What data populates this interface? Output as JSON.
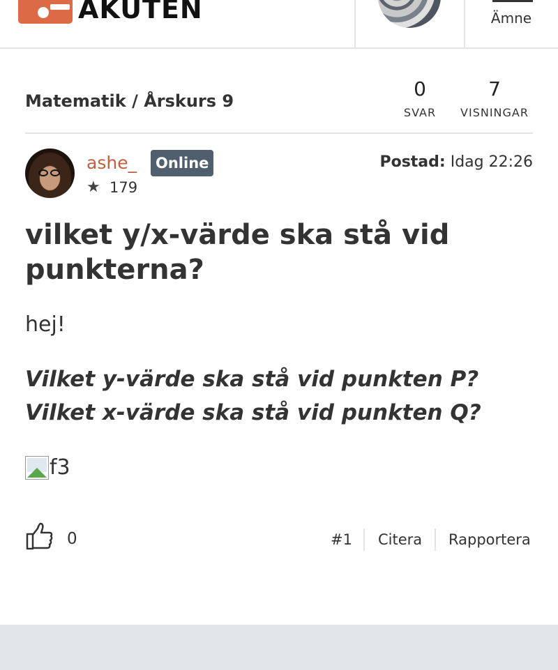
{
  "header": {
    "logo_text": "AKUTEN",
    "menu_label": "Ämne"
  },
  "breadcrumb": {
    "subject": "Matematik",
    "separator": "/",
    "grade": "Årskurs 9"
  },
  "stats": {
    "answers_count": "0",
    "answers_label": "SVAR",
    "views_count": "7",
    "views_label": "VISNINGAR"
  },
  "author": {
    "username": "ashe_",
    "status_badge": "Online",
    "points": "179"
  },
  "posted": {
    "label": "Postad:",
    "time": "Idag 22:26"
  },
  "post": {
    "title": "vilket y/x-värde ska stå vid punkterna?",
    "greeting": "hej!",
    "question": "Vilket y-värde ska stå vid punkten P? Vilket x-värde ska stå vid punkten Q?",
    "image_alt": "f3"
  },
  "actions": {
    "like_count": "0",
    "post_number": "#1",
    "quote_label": "Citera",
    "report_label": "Rapportera"
  },
  "colors": {
    "accent": "#dc6b45",
    "username": "#c0603f",
    "badge_bg": "#4f5f6e",
    "bottom_band": "#e2e6ea"
  }
}
